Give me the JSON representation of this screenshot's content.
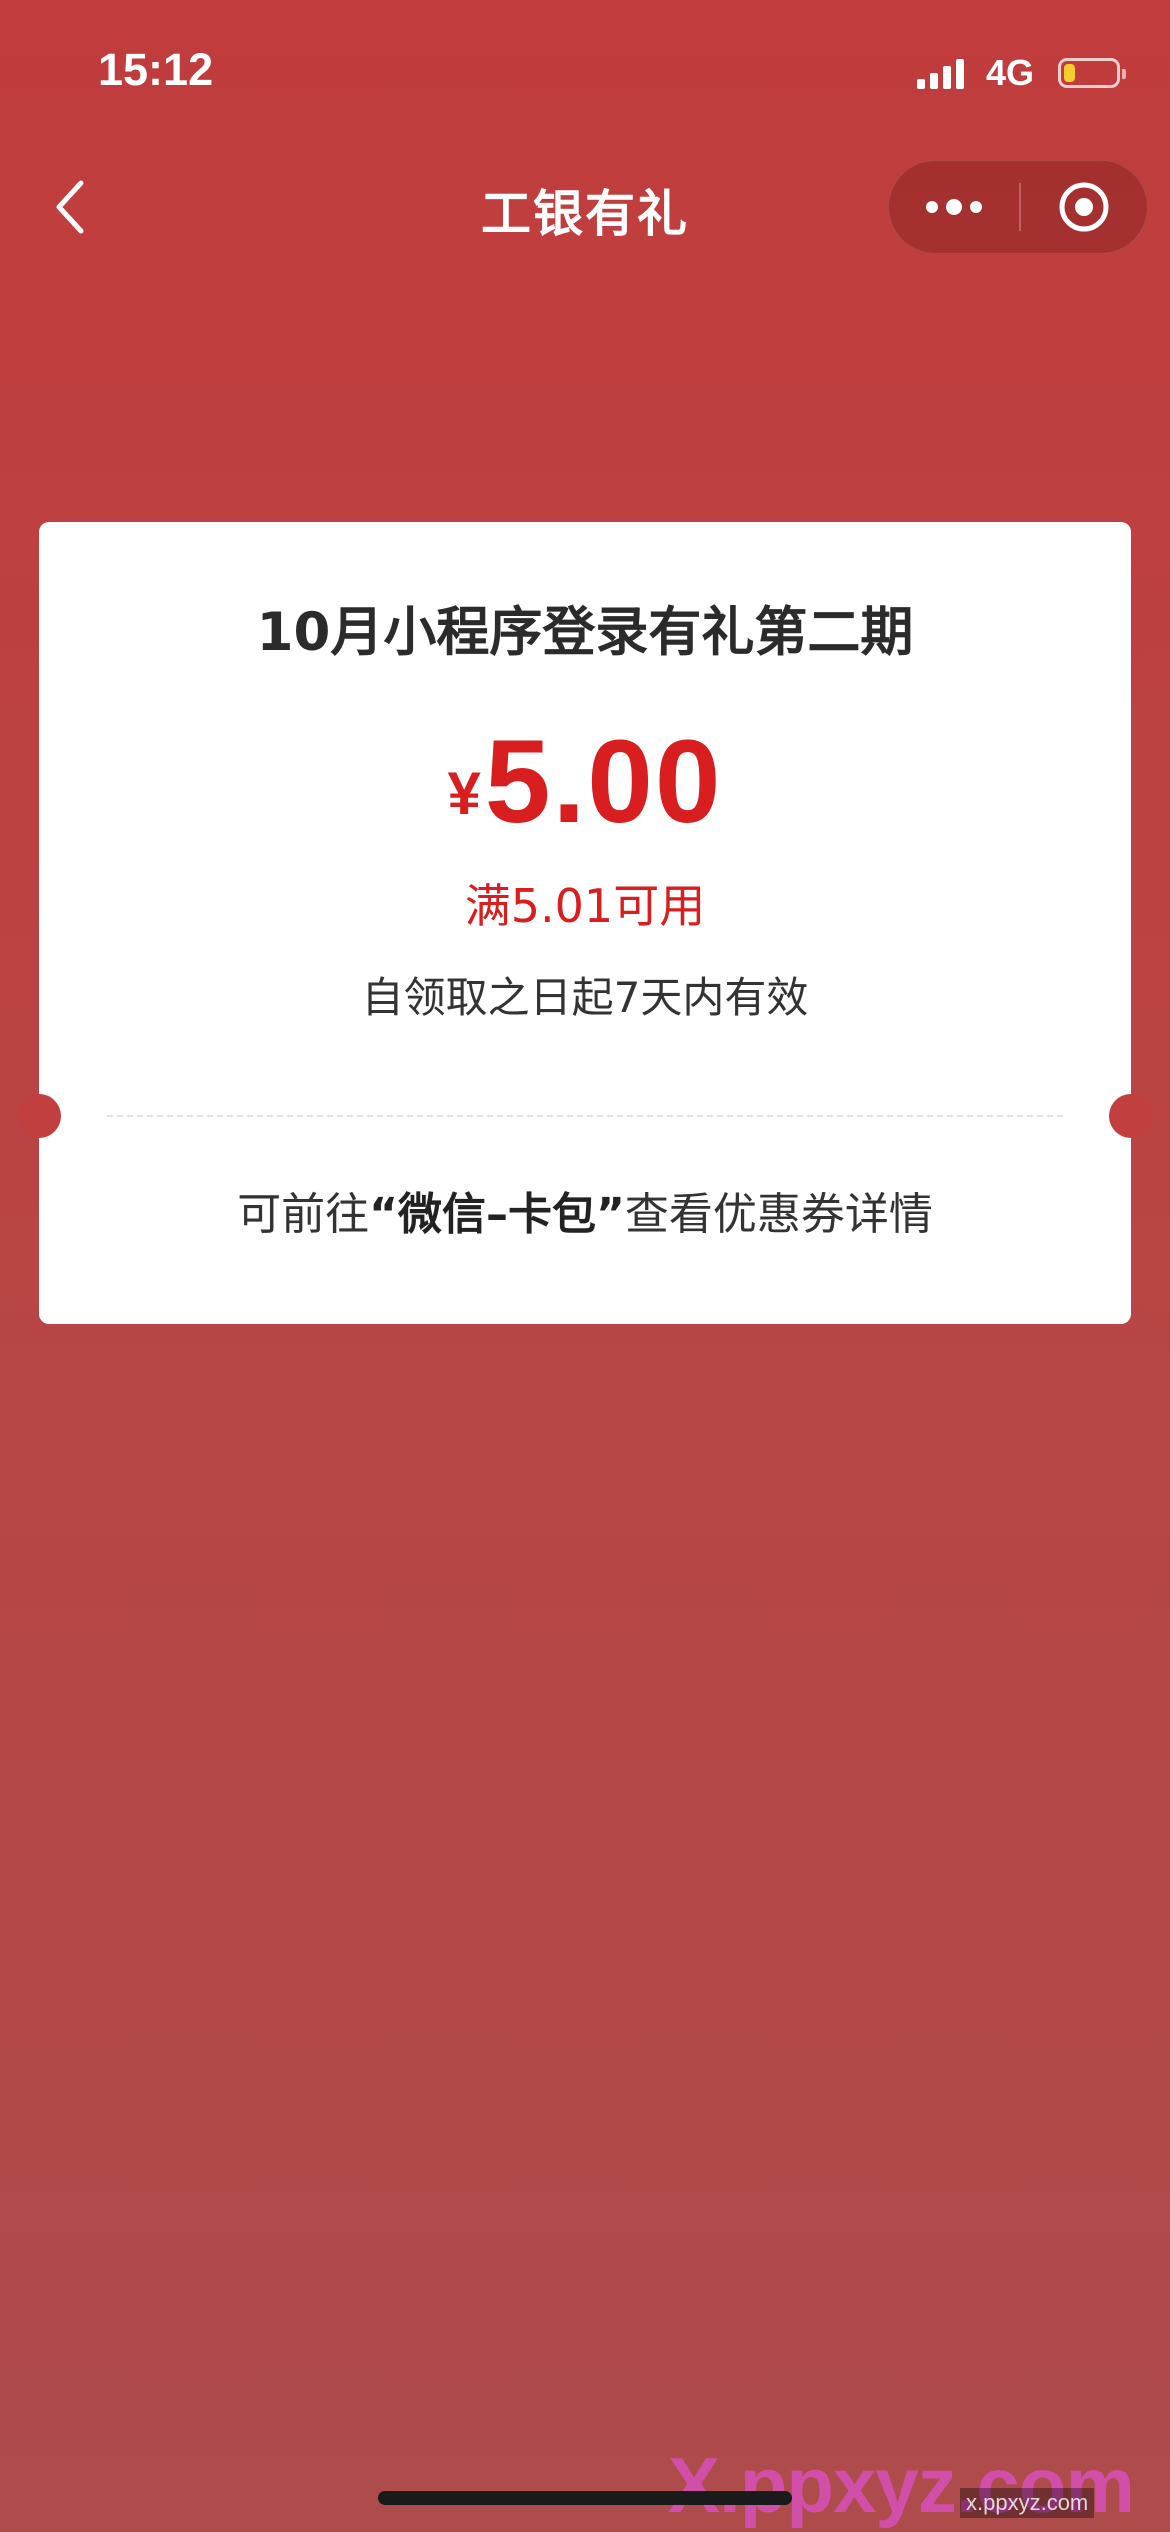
{
  "status_bar": {
    "time": "15:12",
    "network": "4G",
    "battery_level": 0.22,
    "signal_bars": 4
  },
  "nav": {
    "title": "工银有礼",
    "back_icon": "chevron-left-icon",
    "more_icon": "more-dots-icon",
    "close_icon": "target-circle-icon"
  },
  "coupon": {
    "title": "10月小程序登录有礼第二期",
    "currency_symbol": "¥",
    "amount": "5.00",
    "condition": "满5.01可用",
    "validity": "自领取之日起7天内有效",
    "footer_prefix": "可前往",
    "footer_highlight": "“微信–卡包”",
    "footer_suffix": "查看优惠券详情"
  },
  "watermark": {
    "text": "X.ppxyz.com",
    "small_text": "x.ppxyz.com"
  },
  "colors": {
    "background": "#c13c3c",
    "accent_red": "#d81e1e",
    "card_bg": "#ffffff",
    "battery_fill": "#f7cc2c"
  }
}
